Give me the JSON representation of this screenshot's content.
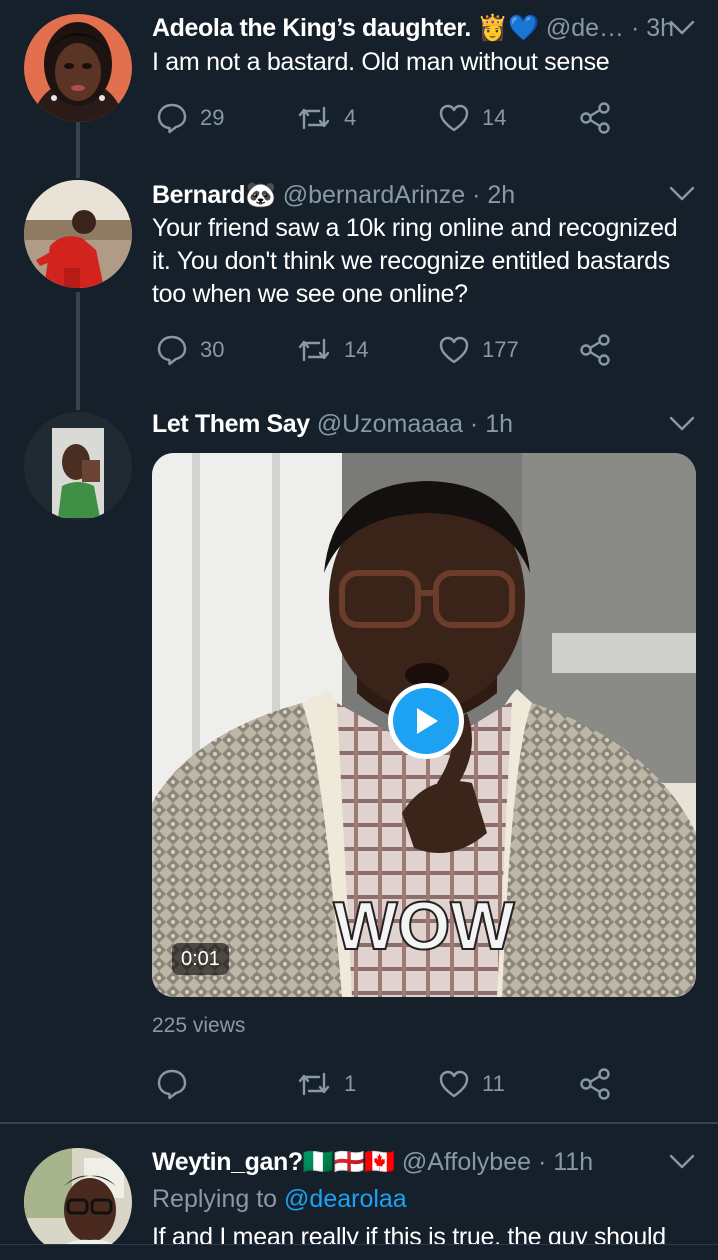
{
  "colors": {
    "background": "#15202b",
    "muted": "#8899a6",
    "accent": "#1da1f2",
    "divider": "#38444d"
  },
  "tweets": [
    {
      "name": "Adeola the King’s daughter. 👸💙",
      "handle": "@de…",
      "sep": " · ",
      "time": "3h",
      "text": "I am not a bastard. Old man without sense",
      "replies": "29",
      "retweets": "4",
      "likes": "14"
    },
    {
      "name": "Bernard🐼",
      "handle": "@bernardArinze",
      "sep": " · ",
      "time": "2h",
      "text": "Your friend saw a 10k ring online and recognized it. You don't think we recognize entitled bastards too when we see one online?",
      "replies": "30",
      "retweets": "14",
      "likes": "177"
    },
    {
      "name": "Let Them Say",
      "handle": "@Uzomaaaa",
      "sep": " · ",
      "time": "1h",
      "media": {
        "caption": "WOW",
        "duration": "0:01",
        "icon": "play-icon"
      },
      "views": "225 views",
      "replies": "",
      "retweets": "1",
      "likes": "11"
    },
    {
      "name": "Weytin_gan?🇳🇬🏴󠁧󠁢󠁥󠁮󠁧󠁿🇨🇦",
      "handle": "@Affolybee",
      "sep": " · ",
      "time": "11h",
      "replying_prefix": "Replying to ",
      "replying_handle": "@dearolaa",
      "text": "If and I mean really if this is true, the guy should"
    }
  ]
}
